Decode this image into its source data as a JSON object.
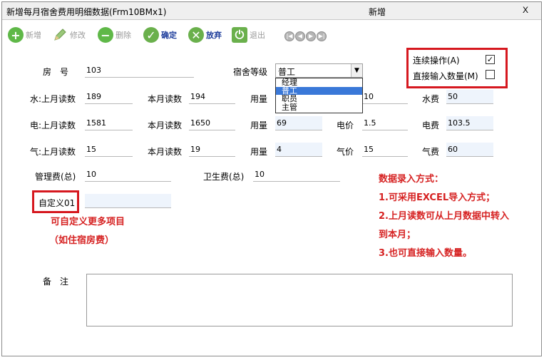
{
  "window": {
    "title": "新增每月宿舍费用明细数据(Frm10BMx1)",
    "mode_label": "新增",
    "close_label": "X"
  },
  "toolbar": {
    "add_label": "新增",
    "edit_label": "修改",
    "delete_label": "删除",
    "confirm_label": "确定",
    "abandon_label": "放弃",
    "exit_label": "退出",
    "nav": [
      "|◀",
      "◀",
      "▶",
      "▶|"
    ]
  },
  "form": {
    "room_label": "房　号",
    "room_value": "103",
    "dorm_level_label": "宿舍等级",
    "dorm_level_value": "普工",
    "dorm_level_options": [
      "经理",
      "普工",
      "职员",
      "主管"
    ],
    "dorm_level_selected_index": 1,
    "water": {
      "prev_label": "水:上月读数",
      "prev_value": "189",
      "curr_label": "本月读数",
      "curr_value": "194",
      "usage_label": "用量",
      "usage_value": "",
      "price_value": "10",
      "fee_label": "水费",
      "fee_value": "50"
    },
    "electric": {
      "prev_label": "电:上月读数",
      "prev_value": "1581",
      "curr_label": "本月读数",
      "curr_value": "1650",
      "usage_label": "用量",
      "usage_value": "69",
      "price_label": "电价",
      "price_value": "1.5",
      "fee_label": "电费",
      "fee_value": "103.5"
    },
    "gas": {
      "prev_label": "气:上月读数",
      "prev_value": "15",
      "curr_label": "本月读数",
      "curr_value": "19",
      "usage_label": "用量",
      "usage_value": "4",
      "price_label": "气价",
      "price_value": "15",
      "fee_label": "气费",
      "fee_value": "60"
    },
    "mgmt_label": "管理费(总)",
    "mgmt_value": "10",
    "sanitation_label": "卫生费(总)",
    "sanitation_value": "10",
    "custom_label": "自定义01",
    "custom_value": "",
    "remark_label": "备　注",
    "remark_value": ""
  },
  "options": {
    "continuous_label": "连续操作(A)",
    "continuous_checked": true,
    "direct_input_label": "直接输入数量(M)",
    "direct_input_checked": false
  },
  "annotations": {
    "custom_note_1": "可自定义更多项目",
    "custom_note_2": "（如住宿房费）",
    "entry_title": "数据录入方式：",
    "entry_1": "1.可采用EXCEL导入方式；",
    "entry_2a": "2.上月读数可从上月数据中转入",
    "entry_2b": "到本月；",
    "entry_3": "3.也可直接输入数量。"
  },
  "colors": {
    "annotation_red": "#d62222",
    "highlight_border": "#d6181f",
    "selected_item": "#3a78d8",
    "field_background": "#eef4fc"
  }
}
